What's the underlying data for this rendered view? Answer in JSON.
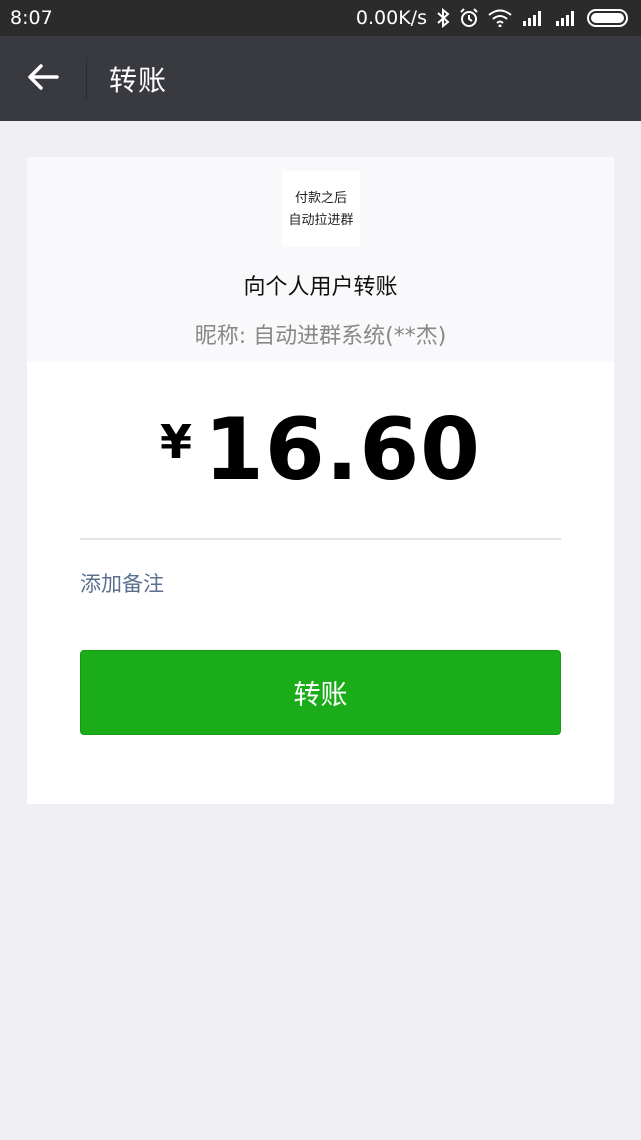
{
  "status_bar": {
    "time": "8:07",
    "network_speed": "0.00K/s",
    "icons": [
      "bluetooth-icon",
      "alarm-icon",
      "wifi-icon",
      "signal-icon",
      "signal-icon",
      "battery-icon"
    ]
  },
  "nav": {
    "back_icon": "arrow-left-icon",
    "title": "转账"
  },
  "recipient": {
    "avatar_line1": "付款之后",
    "avatar_line2": "自动拉进群",
    "type_label": "向个人用户转账",
    "nickname": "昵称: 自动进群系统(**杰)"
  },
  "payment": {
    "currency_symbol": "¥",
    "amount": "16.60",
    "add_note_label": "添加备注",
    "transfer_button_label": "转账"
  },
  "colors": {
    "nav_background": "#393a3f",
    "status_background": "#2b2b2b",
    "button_green": "#1aad19",
    "link_blue": "#5b6f8f",
    "page_background": "#efeff4"
  }
}
